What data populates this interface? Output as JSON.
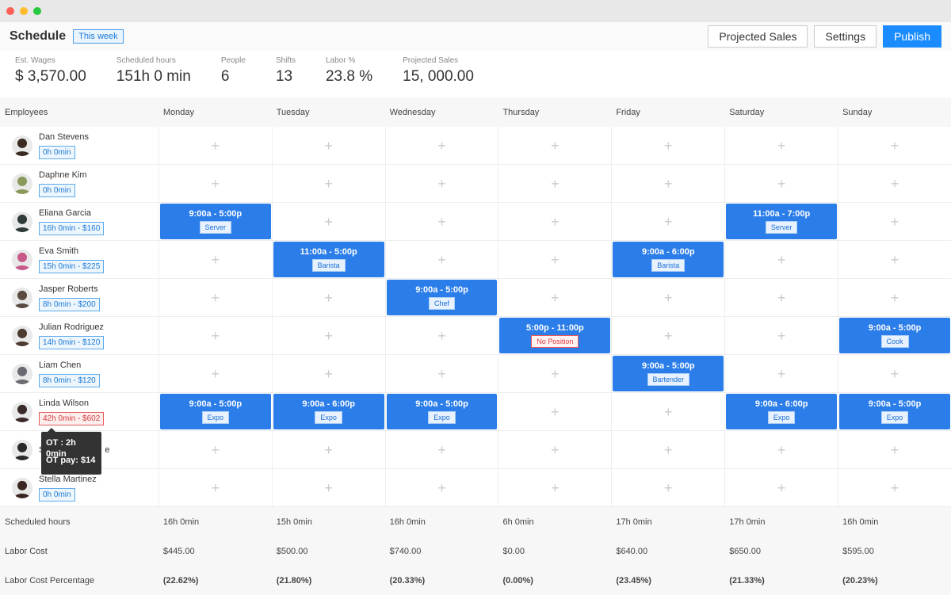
{
  "header": {
    "title": "Schedule",
    "week_badge": "This week",
    "buttons": {
      "projected_sales": "Projected Sales",
      "settings": "Settings",
      "publish": "Publish"
    }
  },
  "stats": [
    {
      "label": "Est. Wages",
      "value": "$ 3,570.00"
    },
    {
      "label": "Scheduled hours",
      "value": "151h 0 min"
    },
    {
      "label": "People",
      "value": "6"
    },
    {
      "label": "Shifts",
      "value": "13"
    },
    {
      "label": "Labor %",
      "value": "23.8 %"
    },
    {
      "label": "Projected Sales",
      "value": "15, 000.00"
    }
  ],
  "columns": {
    "employees": "Employees",
    "days": [
      "Monday",
      "Tuesday",
      "Wednesday",
      "Thursday",
      "Friday",
      "Saturday",
      "Sunday"
    ]
  },
  "employees": [
    {
      "name": "Dan Stevens",
      "hours": "0h 0min",
      "ot": false,
      "avatar_color": "#3a2a20",
      "shifts": [
        null,
        null,
        null,
        null,
        null,
        null,
        null
      ]
    },
    {
      "name": "Daphne Kim",
      "hours": "0h 0min",
      "ot": false,
      "avatar_color": "#8a9a5a",
      "shifts": [
        null,
        null,
        null,
        null,
        null,
        null,
        null
      ]
    },
    {
      "name": "Eliana Garcia",
      "hours": "16h 0min - $160",
      "ot": false,
      "avatar_color": "#2f3a3a",
      "shifts": [
        {
          "time": "9:00a - 5:00p",
          "position": "Server"
        },
        null,
        null,
        null,
        null,
        {
          "time": "11:00a - 7:00p",
          "position": "Server"
        },
        null
      ]
    },
    {
      "name": "Eva Smith",
      "hours": "15h 0min - $225",
      "ot": false,
      "avatar_color": "#c85a8a",
      "shifts": [
        null,
        {
          "time": "11:00a - 5:00p",
          "position": "Barista"
        },
        null,
        null,
        {
          "time": "9:00a - 6:00p",
          "position": "Barista"
        },
        null,
        null
      ]
    },
    {
      "name": "Jasper Roberts",
      "hours": "8h 0min - $200",
      "ot": false,
      "avatar_color": "#5a4a40",
      "shifts": [
        null,
        null,
        {
          "time": "9:00a - 5:00p",
          "position": "Chef"
        },
        null,
        null,
        null,
        null
      ]
    },
    {
      "name": "Julian Rodriguez",
      "hours": "14h 0min - $120",
      "ot": false,
      "avatar_color": "#4a3a30",
      "shifts": [
        null,
        null,
        null,
        {
          "time": "5:00p - 11:00p",
          "position": "No Position",
          "none": true
        },
        null,
        null,
        {
          "time": "9:00a - 5:00p",
          "position": "Cook"
        }
      ]
    },
    {
      "name": "Liam Chen",
      "hours": "8h 0min - $120",
      "ot": false,
      "avatar_color": "#6a6a70",
      "shifts": [
        null,
        null,
        null,
        null,
        {
          "time": "9:00a - 5:00p",
          "position": "Bartender"
        },
        null,
        null
      ]
    },
    {
      "name": "Linda Wilson",
      "hours": "42h 0min - $602",
      "ot": true,
      "avatar_color": "#3a2a2a",
      "shifts": [
        {
          "time": "9:00a - 5:00p",
          "position": "Expo"
        },
        {
          "time": "9:00a - 6:00p",
          "position": "Expo"
        },
        {
          "time": "9:00a - 5:00p",
          "position": "Expo"
        },
        null,
        null,
        {
          "time": "9:00a - 6:00p",
          "position": "Expo"
        },
        {
          "time": "9:00a - 5:00p",
          "position": "Expo"
        }
      ]
    },
    {
      "name": "S",
      "name_suffix": "e",
      "hours": "",
      "ot": false,
      "avatar_color": "#2a2a2a",
      "shifts": [
        null,
        null,
        null,
        null,
        null,
        null,
        null
      ]
    },
    {
      "name": "Stella Martinez",
      "hours": "0h 0min",
      "ot": false,
      "avatar_color": "#3a2520",
      "shifts": [
        null,
        null,
        null,
        null,
        null,
        null,
        null
      ]
    }
  ],
  "tooltip": {
    "ot": "OT : 2h 0min",
    "ot_pay": "OT pay: $14"
  },
  "footer": [
    {
      "label": "Scheduled hours",
      "bold": false,
      "values": [
        "16h 0min",
        "15h 0min",
        "16h 0min",
        "6h 0min",
        "17h 0min",
        "17h 0min",
        "16h 0min"
      ]
    },
    {
      "label": "Labor Cost",
      "bold": false,
      "values": [
        "$445.00",
        "$500.00",
        "$740.00",
        "$0.00",
        "$640.00",
        "$650.00",
        "$595.00"
      ]
    },
    {
      "label": "Labor Cost Percentage",
      "bold": true,
      "values": [
        "(22.62%)",
        "(21.80%)",
        "(20.33%)",
        "(0.00%)",
        "(23.45%)",
        "(21.33%)",
        "(20.23%)"
      ]
    }
  ],
  "colors": {
    "accent": "#2b7de9",
    "publish": "#1a8cff",
    "overtime": "#e85a5a"
  }
}
